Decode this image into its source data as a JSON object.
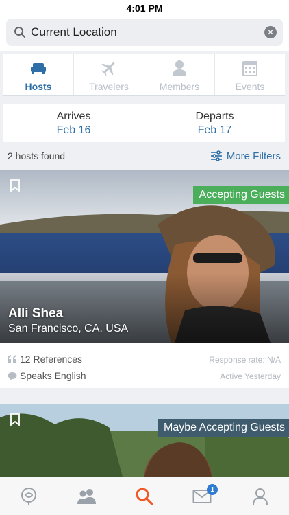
{
  "status_bar": {
    "time": "4:01 PM"
  },
  "search": {
    "value": "Current Location"
  },
  "tabs": [
    {
      "label": "Hosts",
      "icon": "couch-icon",
      "active": true
    },
    {
      "label": "Travelers",
      "icon": "airplane-icon",
      "active": false
    },
    {
      "label": "Members",
      "icon": "person-icon",
      "active": false
    },
    {
      "label": "Events",
      "icon": "calendar-icon",
      "active": false
    }
  ],
  "dates": {
    "arrives_label": "Arrives",
    "arrives_value": "Feb 16",
    "departs_label": "Departs",
    "departs_value": "Feb 17"
  },
  "results": {
    "count_text": "2 hosts found",
    "filters_label": "More Filters"
  },
  "hosts": [
    {
      "name": "Alli Shea",
      "location": "San Francisco, CA, USA",
      "status": "Accepting Guests",
      "references": "12 References",
      "languages": "Speaks English",
      "response_rate": "Response rate: N/A",
      "activity": "Active Yesterday"
    },
    {
      "status": "Maybe Accepting Guests"
    }
  ],
  "bottom_nav": [
    {
      "icon": "couchsurfing-logo-icon"
    },
    {
      "icon": "people-icon"
    },
    {
      "icon": "search-icon",
      "active": true
    },
    {
      "icon": "messages-icon",
      "badge": "1"
    },
    {
      "icon": "profile-icon"
    }
  ],
  "colors": {
    "accent": "#2e6fa7",
    "active_search": "#f05a28",
    "accepting": "#4aae5a",
    "maybe": "#3f5c6e"
  }
}
